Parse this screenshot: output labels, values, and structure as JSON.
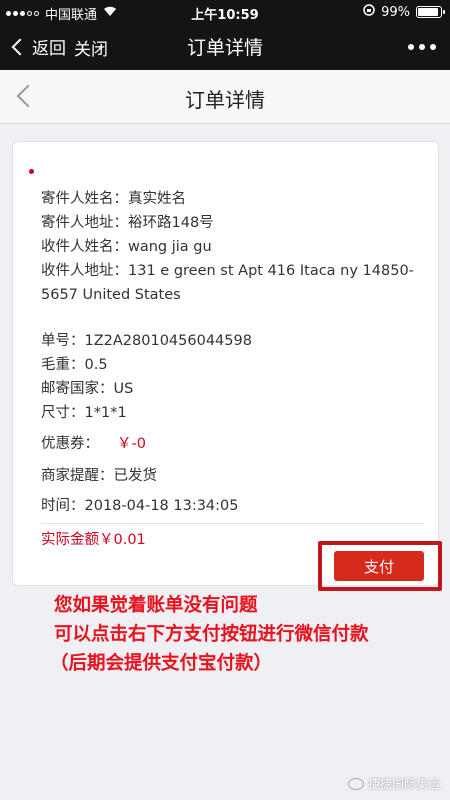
{
  "statusbar": {
    "carrier": "中国联通",
    "time": "上午10:59",
    "battery": "99%",
    "battery_level": 0.99
  },
  "navbar": {
    "back_label": "返回",
    "close_label": "关闭",
    "title": "订单详情"
  },
  "page": {
    "title": "订单详情"
  },
  "order": {
    "sender_name": "寄件人姓名：真实姓名",
    "sender_address": "寄件人地址：裕环路148号",
    "receiver_name": "收件人姓名：wang jia gu",
    "receiver_address_1": "收件人地址：131 e green st Apt 416 Itaca ny 14850-",
    "receiver_address_2": "5657 United States",
    "tracking": "单号：1Z2A28010456044598",
    "weight": "毛重：0.5",
    "country": "邮寄国家：US",
    "size": "尺寸：1*1*1",
    "coupon_label": "优惠券：",
    "coupon_value": "￥-0",
    "merchant_remind": "商家提醒：已发货",
    "time": "时间：2018-04-18 13:34:05",
    "actual_amount": "实际金额￥0.01"
  },
  "pay_button": "支付",
  "annotation": {
    "line1": "您如果觉着账单没有问题",
    "line2": "可以点击右下方支付按钮进行微信付款",
    "line3": "（后期会提供支付宝付款）"
  },
  "watermark": "捷捷国际集运"
}
